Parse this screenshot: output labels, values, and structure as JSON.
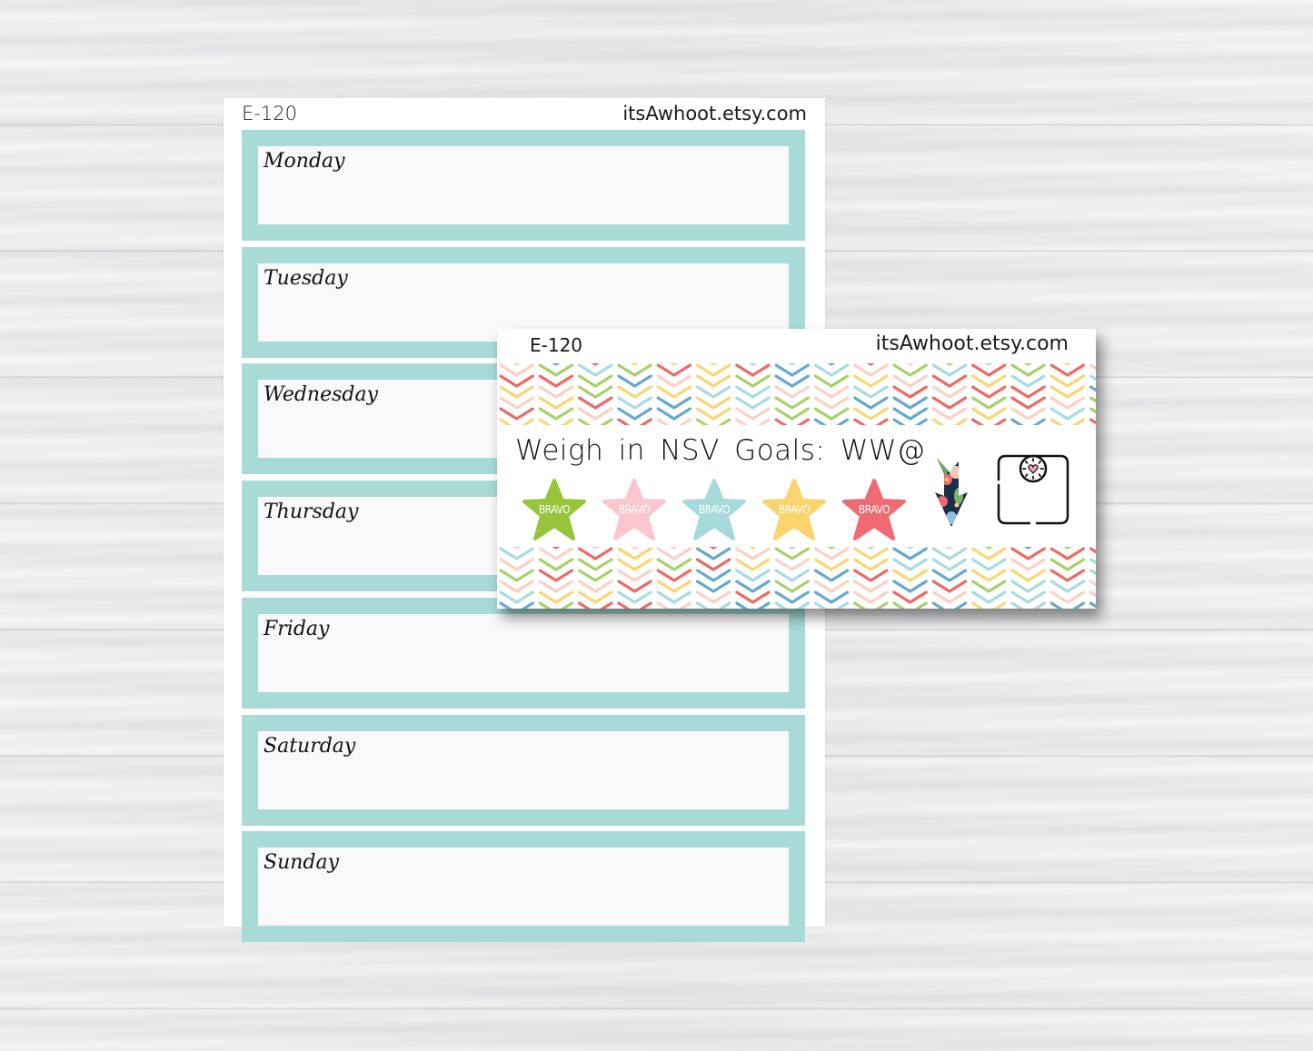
{
  "main_sheet": {
    "code": "E-120",
    "shop_url": "itsAwhoot.etsy.com",
    "accent_color": "#a8dbd8",
    "days": [
      {
        "label": "Monday"
      },
      {
        "label": "Tuesday"
      },
      {
        "label": "Wednesday"
      },
      {
        "label": "Thursday"
      },
      {
        "label": "Friday"
      },
      {
        "label": "Saturday"
      },
      {
        "label": "Sunday"
      }
    ]
  },
  "overlay_card": {
    "code": "E-120",
    "shop_url": "itsAwhoot.etsy.com",
    "title": "Weigh in  NSV  Goals:  WW@",
    "pattern_colors": [
      "#ec6a66",
      "#a7d16a",
      "#f8d675",
      "#66a9cc",
      "#a8dbe0",
      "#fbd1c4"
    ],
    "stars": [
      {
        "label": "BRAVO",
        "color": "#97c43b"
      },
      {
        "label": "BRAVO",
        "color": "#f9c7cd"
      },
      {
        "label": "BRAVO",
        "color": "#a6dada"
      },
      {
        "label": "BRAVO",
        "color": "#fbd46d"
      },
      {
        "label": "BRAVO",
        "color": "#ef6a73"
      }
    ],
    "icons": [
      "floral-down-arrow-icon",
      "bathroom-scale-icon"
    ]
  }
}
